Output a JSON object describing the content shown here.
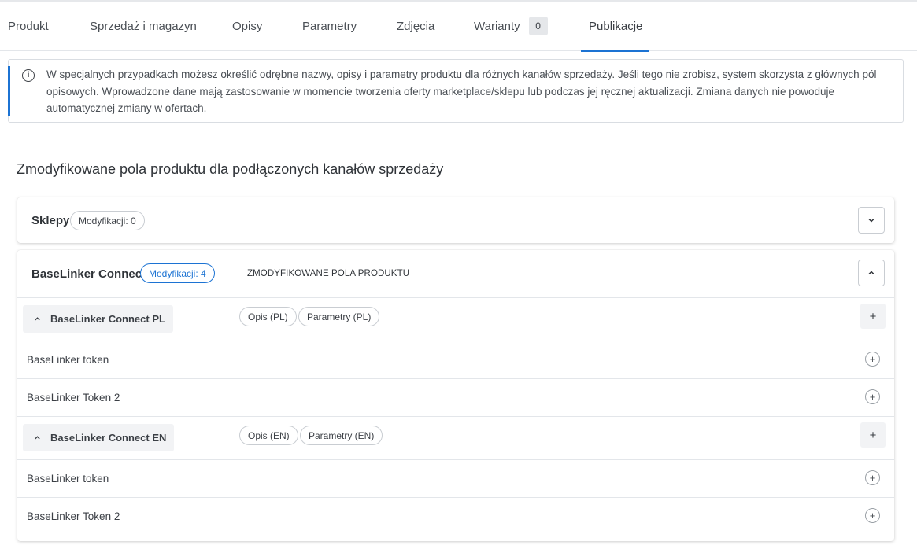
{
  "tabs": [
    {
      "label": "Produkt"
    },
    {
      "label": "Sprzedaż i magazyn"
    },
    {
      "label": "Opisy"
    },
    {
      "label": "Parametry"
    },
    {
      "label": "Zdjęcia"
    },
    {
      "label": "Warianty",
      "badge": "0"
    },
    {
      "label": "Publikacje",
      "active": true
    }
  ],
  "info": {
    "icon": "info-icon",
    "text": "W specjalnych przypadkach możesz określić odrębne nazwy, opisy i parametry produktu dla różnych kanałów sprzedaży. Jeśli tego nie zrobisz, system skorzysta z głównych pól opisowych. Wprowadzone dane mają zastosowanie w momencie tworzenia oferty marketplace/sklepu lub podczas jej ręcznej aktualizacji. Zmiana danych nie powoduje automatycznej zmiany w ofertach."
  },
  "section_title": "Zmodyfikowane pola produktu dla podłączonych kanałów sprzedaży",
  "sklepy": {
    "title": "Sklepy",
    "modifications": "Modyfikacji: 0",
    "toggle_icon": "chevron-down-icon"
  },
  "baselinker": {
    "title": "BaseLinker Connect",
    "modifications": "Modyfikacji: 4",
    "caption": "ZMODYFIKOWANE POLA PRODUKTU",
    "toggle_icon": "chevron-up-icon",
    "groups": [
      {
        "name": "BaseLinker Connect PL",
        "tags": [
          "Opis (PL)",
          "Parametry (PL)"
        ],
        "add": "+",
        "rows": [
          "BaseLinker token",
          "BaseLinker Token 2"
        ]
      },
      {
        "name": "BaseLinker Connect EN",
        "tags": [
          "Opis (EN)",
          "Parametry (EN)"
        ],
        "add": "+",
        "rows": [
          "BaseLinker token",
          "BaseLinker Token 2"
        ]
      }
    ]
  },
  "colors": {
    "accent": "#1c73d3",
    "border": "#e3e6ea",
    "chip_bg": "#f2f3f5"
  }
}
